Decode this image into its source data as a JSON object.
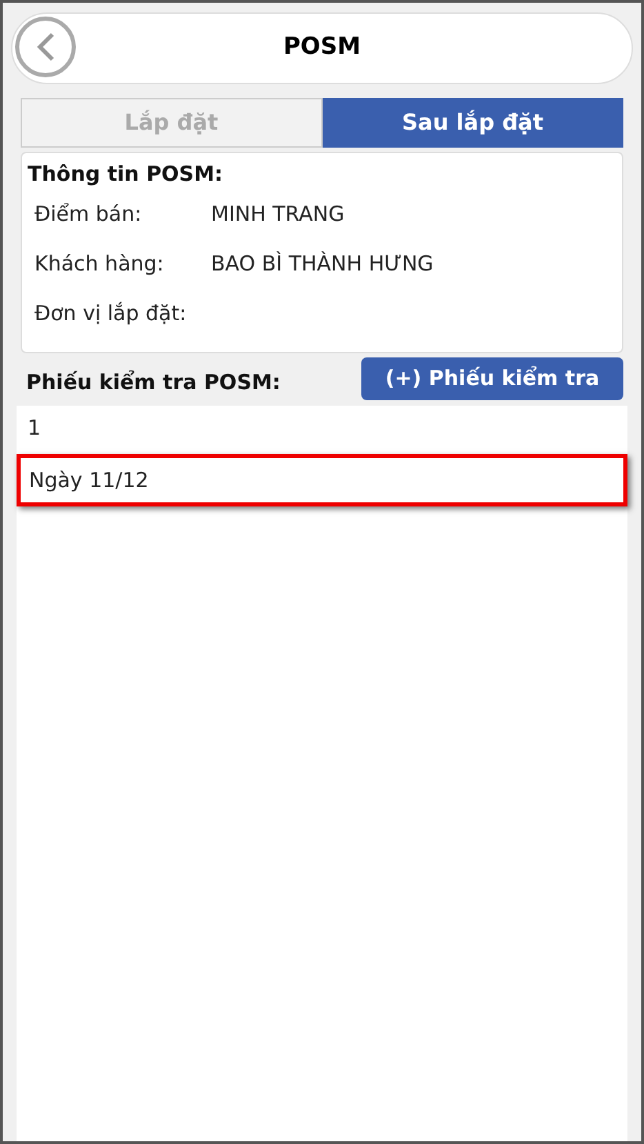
{
  "header": {
    "title": "POSM"
  },
  "tabs": [
    {
      "label": "Lắp đặt",
      "selected": false
    },
    {
      "label": "Sau lắp đặt",
      "selected": true
    }
  ],
  "info": {
    "title": "Thông tin POSM:",
    "fields": [
      {
        "label": "Điểm bán:",
        "value": "MINH TRANG"
      },
      {
        "label": "Khách hàng:",
        "value": "BAO BÌ THÀNH HƯNG"
      },
      {
        "label": "Đơn vị lắp đặt:"
      }
    ]
  },
  "checklist": {
    "title": "Phiếu kiểm tra POSM:",
    "add_button": "(+) Phiếu kiểm tra",
    "items": [
      {
        "label": "1",
        "selected": false
      },
      {
        "label": "Ngày 11/12",
        "selected": true
      }
    ]
  }
}
